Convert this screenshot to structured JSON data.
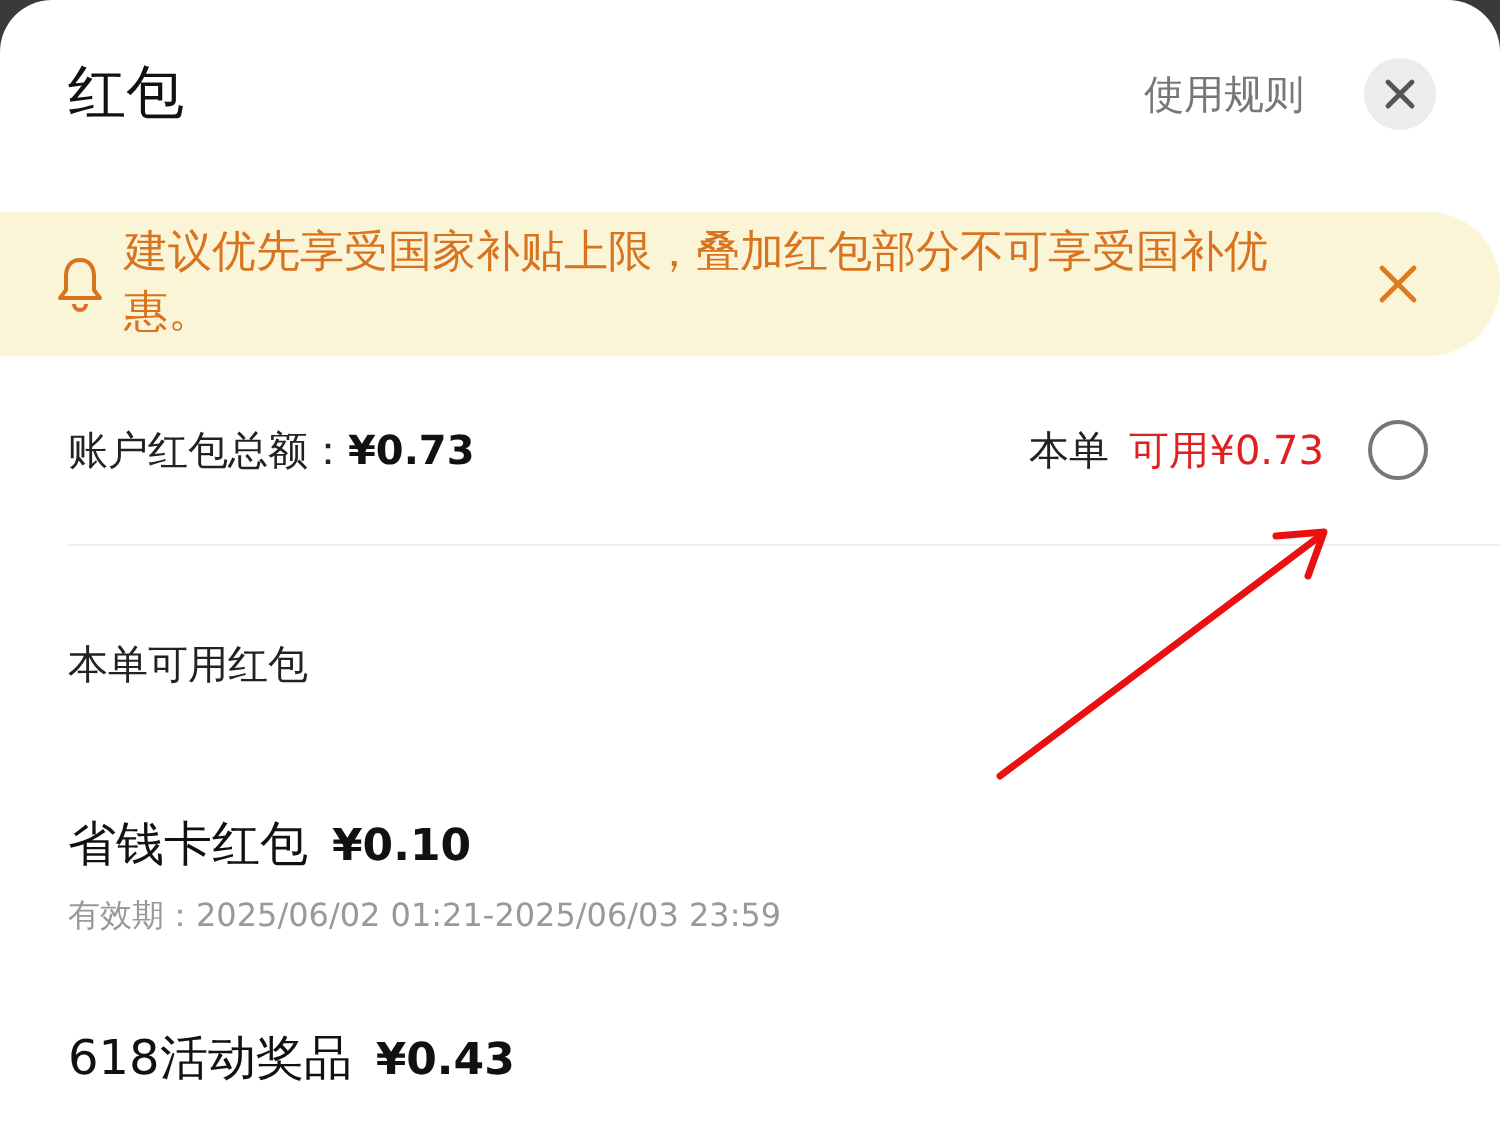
{
  "header": {
    "title": "红包",
    "rules_link": "使用规则"
  },
  "notice": {
    "text": "建议优先享受国家补贴上限，叠加红包部分不可享受国补优惠。"
  },
  "summary": {
    "label": "账户红包总额：",
    "total": "¥0.73",
    "order_label": "本单",
    "order_available": "可用¥0.73",
    "checked": false
  },
  "section_title": "本单可用红包",
  "coupons": [
    {
      "name": "省钱卡红包",
      "amount": "¥0.10",
      "validity": "有效期：2025/06/02 01:21-2025/06/03 23:59"
    },
    {
      "name": "618活动奖品",
      "amount": "¥0.43"
    }
  ]
}
